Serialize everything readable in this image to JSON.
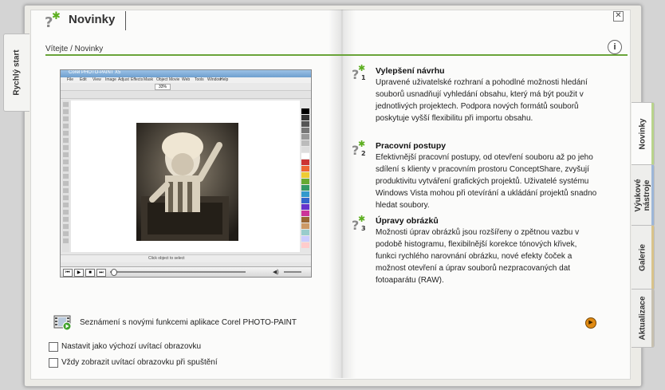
{
  "header": {
    "title": "Novinky",
    "breadcrumb": "Vítejte / Novinky",
    "close_glyph": "✕",
    "info_glyph": "i"
  },
  "left_tab": {
    "label": "Rychlý start"
  },
  "right_tabs": [
    {
      "label": "Novinky",
      "accent": "#b9d48c"
    },
    {
      "label": "Výukové nástroje",
      "accent": "#9db6d8"
    },
    {
      "label": "Galerie",
      "accent": "#d9c38a"
    },
    {
      "label": "Aktualizace",
      "accent": "#c7c0b0"
    }
  ],
  "video": {
    "caption": "Seznámení s novými funkcemi aplikace Corel PHOTO-PAINT",
    "icon": "film-icon",
    "status_text": "Click object to select",
    "app_title": "Corel PHOTO-PAINT X5",
    "menu": [
      "File",
      "Edit",
      "View",
      "Image",
      "Adjust",
      "Effects",
      "Mask",
      "Object",
      "Movie",
      "Web",
      "Tools",
      "Window",
      "Help"
    ],
    "zoom": "33%"
  },
  "features": [
    {
      "number": "1",
      "title": "Vylepšení návrhu",
      "body": "Upravené uživatelské rozhraní a pohodlné možnosti hledání souborů usnadňují vyhledání obsahu, který má být použit v jednotlivých projektech. Podpora nových formátů souborů poskytuje vyšší flexibilitu při importu obsahu."
    },
    {
      "number": "2",
      "title": "Pracovní postupy",
      "body": "Efektivnější pracovní postupy, od otevření souboru až po jeho sdílení s klienty v pracovním prostoru ConceptShare, zvyšují produktivitu vytváření grafických projektů. Uživatelé systému Windows Vista mohou při otevírání a ukládání projektů snadno hledat soubory."
    },
    {
      "number": "3",
      "title": "Úpravy obrázků",
      "body": "Možnosti úprav obrázků jsou rozšířeny o zpětnou vazbu v podobě histogramu, flexibilnější korekce tónových křivek, funkci rychlého narovnání obrázku, nové efekty čoček a možnost otevření a úprav souborů nezpracovaných dat fotoaparátu (RAW)."
    }
  ],
  "checkboxes": [
    {
      "label": "Nastavit jako výchozí uvítací obrazovku",
      "checked": false
    },
    {
      "label": "Vždy zobrazit uvítací obrazovku při spuštění",
      "checked": false
    }
  ],
  "colors": {
    "accent_green": "#6aa43a",
    "star_green": "#5cae1f",
    "next_orange": "#e08a12"
  },
  "icons": {
    "logo": "question-star-logo-icon",
    "next": "next-arrow-icon"
  }
}
